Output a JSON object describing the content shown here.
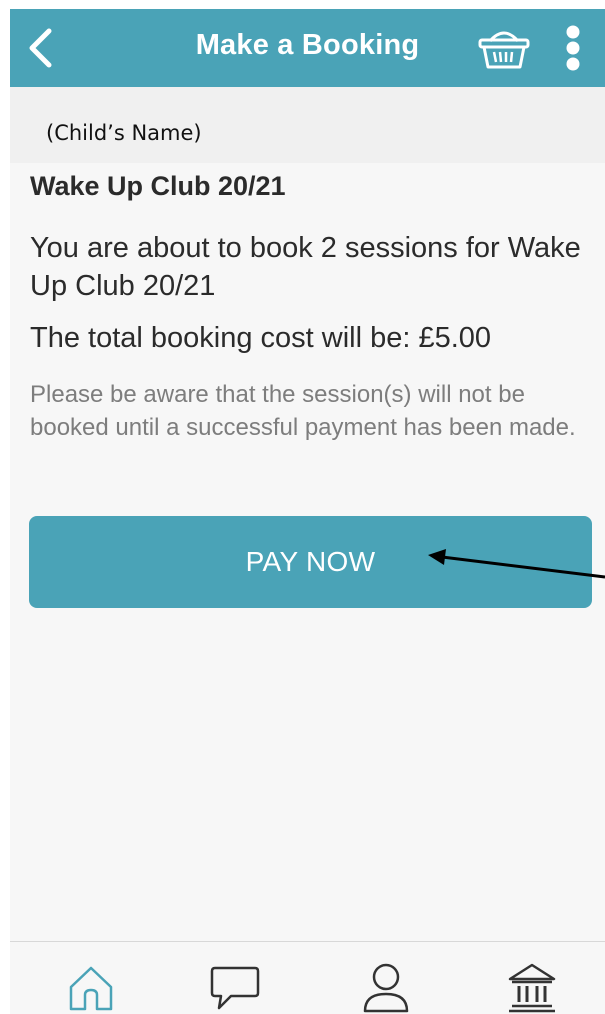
{
  "header": {
    "title": "Make a Booking",
    "back_icon": "chevron-left-icon",
    "basket_icon": "basket-icon",
    "menu_icon": "vertical-dots-icon"
  },
  "booking": {
    "child_name": "(Child’s Name)",
    "club_title": "Wake Up Club 20/21",
    "book_text": "You are about to book 2 sessions for Wake Up Club 20/21",
    "cost_text": "The total booking cost will be: £5.00",
    "aware_text": "Please be aware that the session(s) will not be booked until a successful payment has been made.",
    "pay_label": "PAY NOW"
  },
  "tabbar": {
    "items": [
      {
        "icon": "home-icon",
        "active": true
      },
      {
        "icon": "chat-icon",
        "active": false
      },
      {
        "icon": "profile-icon",
        "active": false
      },
      {
        "icon": "bank-icon",
        "active": false
      }
    ]
  },
  "colors": {
    "accent": "#4aa3b7",
    "background": "#f7f7f7",
    "text_primary": "#2b2b2b",
    "text_secondary": "#7d7d7d"
  }
}
